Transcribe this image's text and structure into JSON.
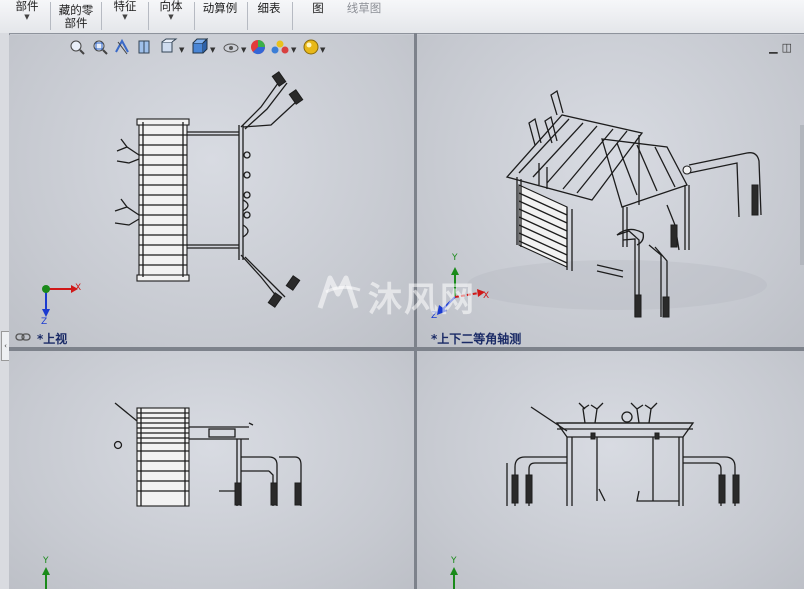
{
  "ribbon": {
    "buttons": [
      {
        "label": "部件",
        "has_arrow": true
      },
      {
        "label_line1": "藏的零",
        "label_line2": "部件"
      },
      {
        "label": "特征",
        "has_arrow": true
      },
      {
        "label": "向体",
        "has_arrow": true
      },
      {
        "label": "动算例"
      },
      {
        "label": "细表"
      },
      {
        "label": "图"
      },
      {
        "label": "线草图",
        "disabled": true
      }
    ]
  },
  "viewports": {
    "top_view": {
      "label": "*上视"
    },
    "isometric_view": {
      "label": "*上下二等角轴测"
    },
    "front_view": {},
    "side_view": {}
  },
  "triad": {
    "x": "X",
    "y": "Y",
    "z": "Z"
  },
  "watermark": {
    "text": "沐风网"
  },
  "colors": {
    "triad_x": "#d01818",
    "triad_y": "#1a8a1a",
    "triad_z": "#1a3ad0",
    "label": "#1a2a66"
  },
  "icons": {
    "hud": [
      "zoom-to-fit-icon",
      "zoom-area-icon",
      "previous-view-icon",
      "section-view-icon",
      "view-orientation-icon",
      "display-style-icon",
      "hide-show-icon",
      "edit-appearance-icon",
      "apply-scene-icon",
      "view-settings-icon"
    ]
  }
}
